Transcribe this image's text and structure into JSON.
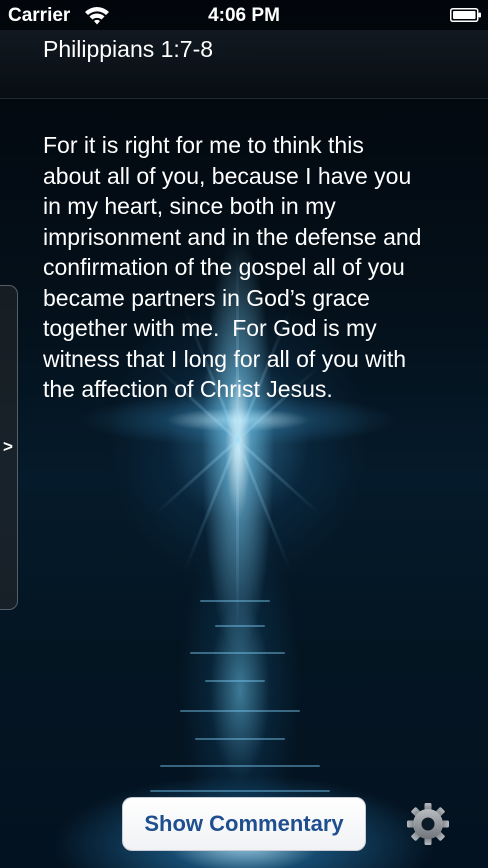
{
  "status_bar": {
    "carrier": "Carrier",
    "time": "4:06 PM",
    "icons": [
      "wifi-icon",
      "battery-icon"
    ]
  },
  "header": {
    "reference": "Philippians 1:7-8"
  },
  "verse": {
    "text": "For it is right for me to think this\nabout all of you, because I have you\nin my heart, since both in my\nimprisonment and in the defense and\nconfirmation of the gospel all of you\nbecame partners in God’s grace\ntogether with me.  For God is my\nwitness that I long for all of you with\nthe affection of Christ Jesus."
  },
  "drawer": {
    "arrow": ">"
  },
  "toolbar": {
    "commentary_label": "Show Commentary",
    "settings_icon": "gear-icon"
  },
  "colors": {
    "button_text": "#1f4f8e",
    "background": "#031220",
    "glow": "#78c8f0"
  }
}
